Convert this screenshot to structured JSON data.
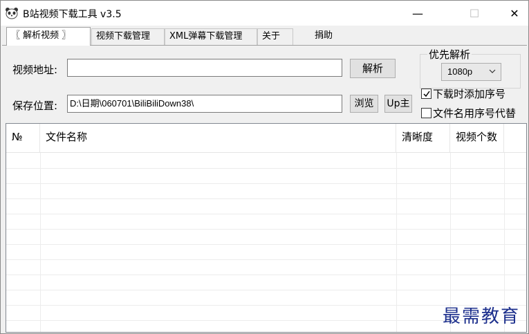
{
  "window": {
    "title": "B站视频下载工具 v3.5",
    "controls": {
      "minimize": "—",
      "maximize": "☐",
      "close": "✕"
    }
  },
  "tabs": [
    {
      "label": "〖 解析视频 〗",
      "active": true
    },
    {
      "label": "视频下载管理",
      "active": false
    },
    {
      "label": "XML弹幕下载管理",
      "active": false
    },
    {
      "label": "关于",
      "active": false
    },
    {
      "label": "捐助",
      "active": false
    }
  ],
  "form": {
    "url_label": "视频地址:",
    "url_value": "",
    "parse_button": "解析",
    "save_label": "保存位置:",
    "save_value": "D:\\日期\\060701\\BiliBiliDown38\\",
    "browse_button": "浏览",
    "up_button": "Up主"
  },
  "priority": {
    "title": "优先解析",
    "selected": "1080p"
  },
  "options": {
    "add_number": {
      "label": "下载时添加序号",
      "checked": true
    },
    "name_with_number": {
      "label": "文件名用序号代替",
      "checked": false
    }
  },
  "table": {
    "columns": [
      "№",
      "文件名称",
      "清晰度",
      "视频个数"
    ],
    "rows": []
  },
  "watermark": "最需教育"
}
